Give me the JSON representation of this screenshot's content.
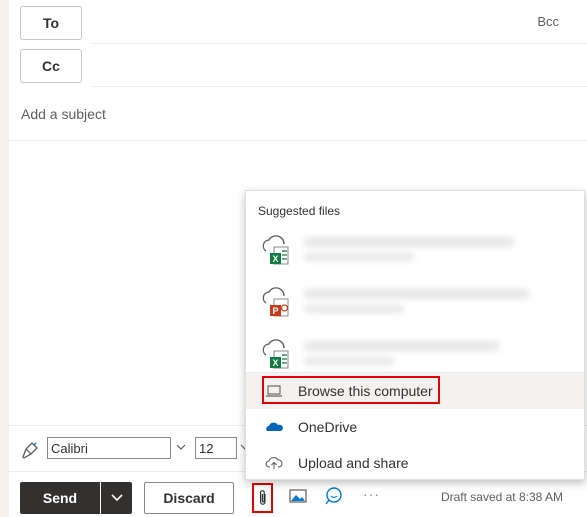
{
  "recipients": {
    "to_label": "To",
    "cc_label": "Cc",
    "bcc_label": "Bcc"
  },
  "subject": {
    "placeholder": "Add a subject"
  },
  "format_bar": {
    "font_name": "Calibri",
    "font_size": "12"
  },
  "actions": {
    "send_label": "Send",
    "discard_label": "Discard",
    "more_label": "···",
    "draft_status": "Draft saved at 8:38 AM"
  },
  "attach_menu": {
    "title": "Suggested files",
    "files": [
      {
        "icon": "excel-cloud-icon"
      },
      {
        "icon": "powerpoint-cloud-icon"
      },
      {
        "icon": "excel-cloud-icon"
      }
    ],
    "items": [
      {
        "label": "Browse this computer",
        "icon": "laptop-icon"
      },
      {
        "label": "OneDrive",
        "icon": "onedrive-icon"
      },
      {
        "label": "Upload and share",
        "icon": "cloud-upload-icon"
      }
    ]
  },
  "colors": {
    "excel_green": "#107c41",
    "powerpoint_orange": "#c43e1c",
    "onedrive_blue": "#0364b8",
    "highlight_red": "#e00000",
    "send_bg": "#323130"
  }
}
